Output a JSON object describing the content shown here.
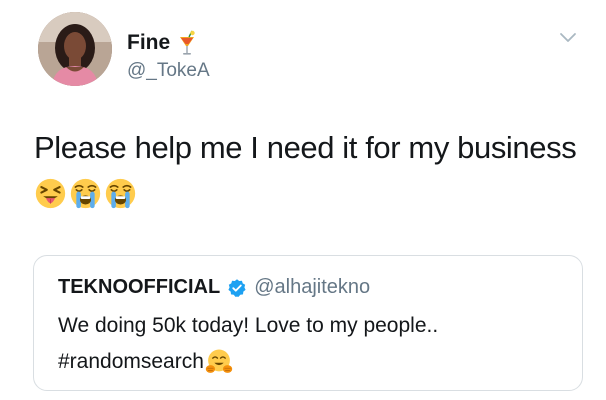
{
  "author": {
    "name": "Fine",
    "handle": "@_TokeA",
    "name_emoji_icon": "tropical-drink-icon"
  },
  "tweet": {
    "text": "Please help me I need it for my business",
    "emojis": [
      "squinting-tongue-icon",
      "loudly-crying-face-icon",
      "loudly-crying-face-icon"
    ]
  },
  "quoted_tweet": {
    "author_name": "TEKNOOFFICIAL",
    "verified_icon": "verified-badge-icon",
    "author_handle": "@alhajitekno",
    "line1": "We doing 50k today! Love to my people..",
    "line2": "#randomsearch",
    "trailing_emoji": "hugging-face-icon"
  },
  "colors": {
    "text_primary": "#14171a",
    "text_secondary": "#657786",
    "border": "#d9dee2",
    "verified_blue": "#1da1f2"
  }
}
